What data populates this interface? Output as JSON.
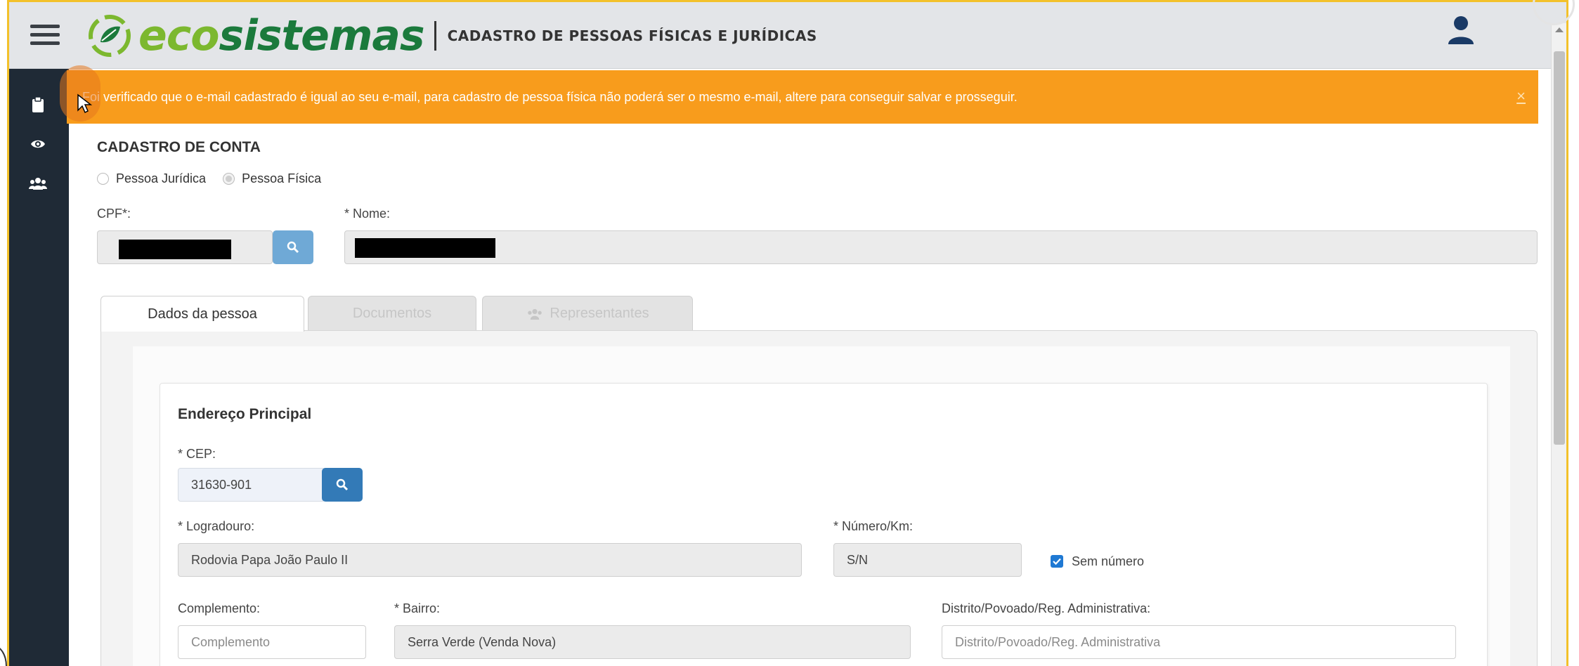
{
  "header": {
    "brand_eco": "eco",
    "brand_sistemas": "sistemas",
    "page_title": "CADASTRO DE PESSOAS FÍSICAS E JURÍDICAS"
  },
  "alert": {
    "message": "Foi verificado que o e-mail cadastrado é igual ao seu e-mail, para cadastro de pessoa física não poderá ser o mesmo e-mail, altere para conseguir salvar e prosseguir.",
    "close": "×",
    "color": "#f89c1c"
  },
  "sidebar": {
    "icons": [
      "clipboard-icon",
      "eye-icon",
      "users-icon"
    ]
  },
  "account": {
    "title": "CADASTRO DE CONTA",
    "radio_juridica": "Pessoa Jurídica",
    "radio_fisica": "Pessoa Física",
    "selected": "Pessoa Física",
    "cpf_label": "CPF*:",
    "nome_label": "* Nome:"
  },
  "tabs": [
    {
      "label": "Dados da pessoa"
    },
    {
      "label": "Documentos"
    },
    {
      "label": "Representantes"
    }
  ],
  "address": {
    "title": "Endereço Principal",
    "cep_label": "* CEP:",
    "cep_value": "31630-901",
    "logradouro_label": "* Logradouro:",
    "logradouro_value": "Rodovia Papa João Paulo II",
    "numero_label": "* Número/Km:",
    "numero_value": "S/N",
    "sem_numero_label": "Sem número",
    "sem_numero_checked": true,
    "complemento_label": "Complemento:",
    "complemento_placeholder": "Complemento",
    "bairro_label": "* Bairro:",
    "bairro_value": "Serra Verde (Venda Nova)",
    "distrito_label": "Distrito/Povoado/Reg. Administrativa:",
    "distrito_placeholder": "Distrito/Povoado/Reg. Administrativa"
  },
  "colors": {
    "accent_blue": "#337ab7",
    "sidebar": "#1f2a36",
    "brand_light_green": "#7cb82f",
    "brand_dark_green": "#1b7a3c"
  }
}
